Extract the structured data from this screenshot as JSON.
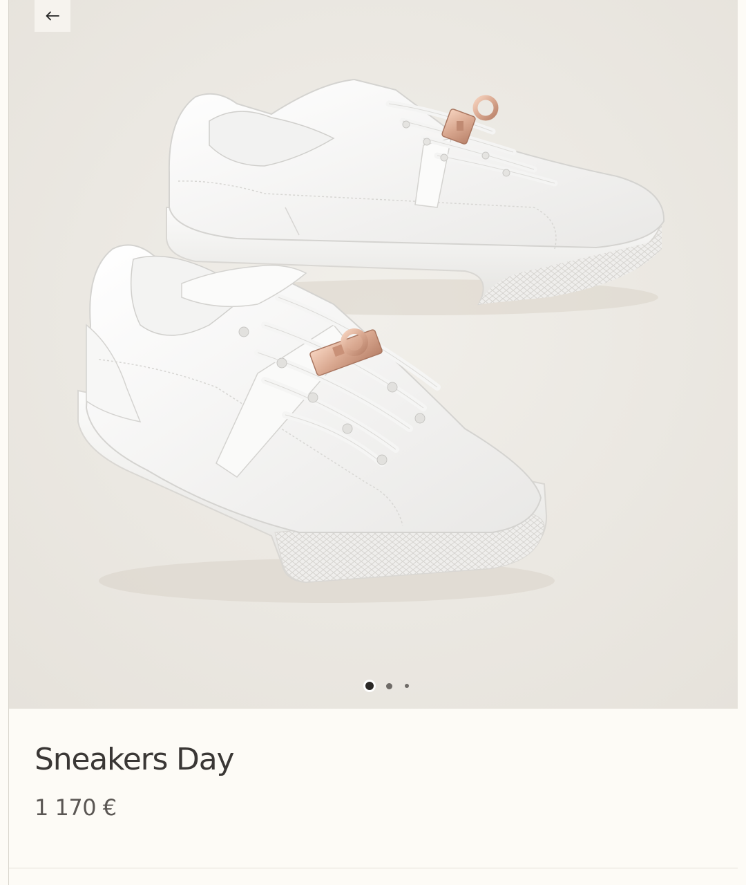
{
  "product": {
    "title": "Sneakers Day",
    "price": "1 170 €"
  },
  "gallery": {
    "image_alt": "product photo: two white leather sneakers with rose gold Kelly buckle",
    "total_slides": 3,
    "active_slide": 1
  },
  "icons": {
    "back": "arrow-left-icon"
  },
  "colors": {
    "background": "#fdfbf6",
    "photo_background": "#ebe8e2",
    "text_primary": "#3a3735",
    "text_secondary": "#5a5653",
    "buckle": "#d9a890"
  }
}
